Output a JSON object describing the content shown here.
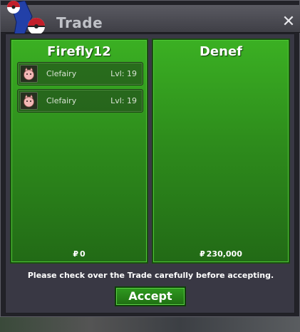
{
  "window": {
    "title": "Trade",
    "close_label": "✕"
  },
  "left_panel": {
    "player_name": "Firefly12",
    "currency_symbol": "₽",
    "money": "0",
    "items": [
      {
        "pokemon": "Clefairy",
        "level": "Lvl: 19",
        "icon": "clefairy-icon"
      },
      {
        "pokemon": "Clefairy",
        "level": "Lvl: 19",
        "icon": "clefairy-icon"
      }
    ]
  },
  "right_panel": {
    "player_name": "Denef",
    "currency_symbol": "₽",
    "money": "230,000",
    "items": []
  },
  "footer": {
    "message": "Please check over the Trade carefully before accepting.",
    "accept_label": "Accept"
  },
  "colors": {
    "panel_green": "#2e8d1c",
    "button_green": "#2f9a1f",
    "title_text": "#bfc1c7"
  }
}
